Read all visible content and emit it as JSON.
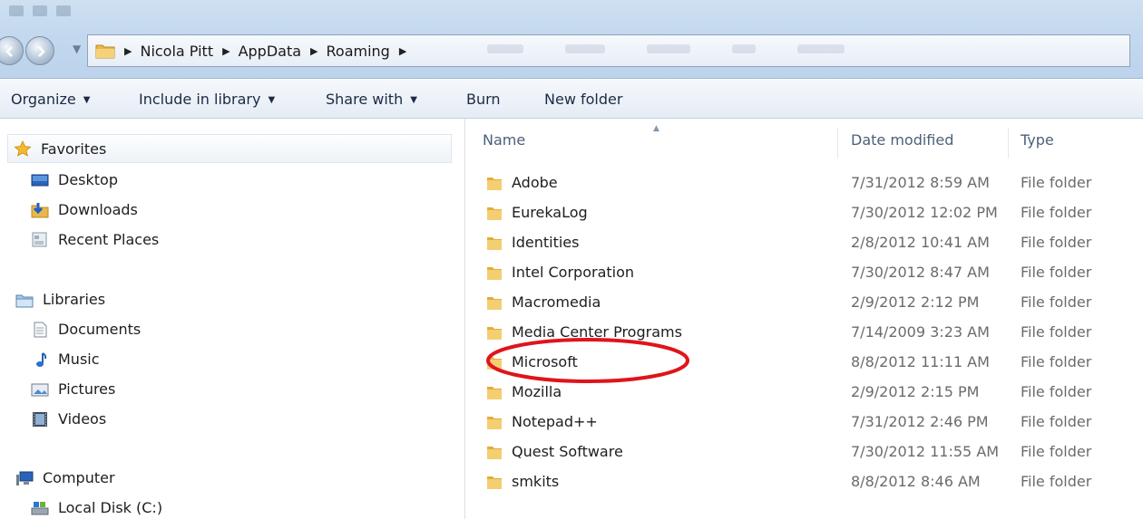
{
  "address_bar": {
    "crumbs": [
      "Nicola Pitt",
      "AppData",
      "Roaming"
    ]
  },
  "toolbar": {
    "organize": "Organize",
    "include_in_library": "Include in library",
    "share_with": "Share with",
    "burn": "Burn",
    "new_folder": "New folder"
  },
  "nav": {
    "favorites": "Favorites",
    "desktop": "Desktop",
    "downloads": "Downloads",
    "recent_places": "Recent Places",
    "libraries": "Libraries",
    "documents": "Documents",
    "music": "Music",
    "pictures": "Pictures",
    "videos": "Videos",
    "computer": "Computer",
    "local_disk": "Local Disk (C:)"
  },
  "columns": {
    "name": "Name",
    "date_modified": "Date modified",
    "type": "Type"
  },
  "files": [
    {
      "name": "Adobe",
      "date": "7/31/2012 8:59 AM",
      "type": "File folder"
    },
    {
      "name": "EurekaLog",
      "date": "7/30/2012 12:02 PM",
      "type": "File folder"
    },
    {
      "name": "Identities",
      "date": "2/8/2012 10:41 AM",
      "type": "File folder"
    },
    {
      "name": "Intel Corporation",
      "date": "7/30/2012 8:47 AM",
      "type": "File folder"
    },
    {
      "name": "Macromedia",
      "date": "2/9/2012 2:12 PM",
      "type": "File folder"
    },
    {
      "name": "Media Center Programs",
      "date": "7/14/2009 3:23 AM",
      "type": "File folder"
    },
    {
      "name": "Microsoft",
      "date": "8/8/2012 11:11 AM",
      "type": "File folder"
    },
    {
      "name": "Mozilla",
      "date": "2/9/2012 2:15 PM",
      "type": "File folder"
    },
    {
      "name": "Notepad++",
      "date": "7/31/2012 2:46 PM",
      "type": "File folder"
    },
    {
      "name": "Quest Software",
      "date": "7/30/2012 11:55 AM",
      "type": "File folder"
    },
    {
      "name": "smkits",
      "date": "8/8/2012 8:46 AM",
      "type": "File folder"
    }
  ],
  "annotation": {
    "highlighted_item": "Microsoft",
    "color": "#e0141b"
  },
  "colors": {
    "titlebar": "#c4d9ef",
    "folder": "#e8b84a"
  }
}
